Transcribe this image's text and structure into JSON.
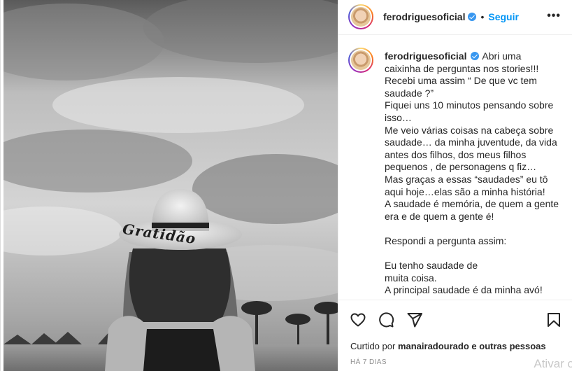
{
  "post": {
    "username": "ferodriguesoficial",
    "follow_label": "Seguir",
    "more_label": "•••",
    "separator": "•",
    "hat_text": "Gratidão"
  },
  "caption": {
    "username": "ferodriguesoficial",
    "text": "Abri uma caixinha de perguntas nos stories!!!\nRecebi uma assim “ De que vc tem saudade ?”\nFiquei uns 10 minutos pensando sobre isso…\nMe veio várias coisas na cabeça sobre saudade… da minha juventude, da vida antes dos filhos, dos meus filhos pequenos , de personagens q fiz…\nMas graças a essas “saudades” eu tô aqui hoje…elas são a minha história!\nA saudade é memória, de quem a gente era e de quem a gente é!\n\nRespondi a pergunta assim:\n\nEu tenho saudade de\nmuita coisa.\nA principal saudade é da minha avó!"
  },
  "actions": {
    "like_icon": "heart-icon",
    "comment_icon": "comment-icon",
    "share_icon": "paper-plane-icon",
    "save_icon": "bookmark-icon"
  },
  "likes": {
    "prefix": "Curtido por",
    "user": "manairadourado",
    "suffix": "e outras pessoas"
  },
  "timestamp": "HÁ 7 DIAS",
  "watermark": "Ativar o",
  "colors": {
    "accent": "#0095f6",
    "verified": "#3897f0",
    "text": "#262626",
    "muted": "#8e8e8e"
  }
}
